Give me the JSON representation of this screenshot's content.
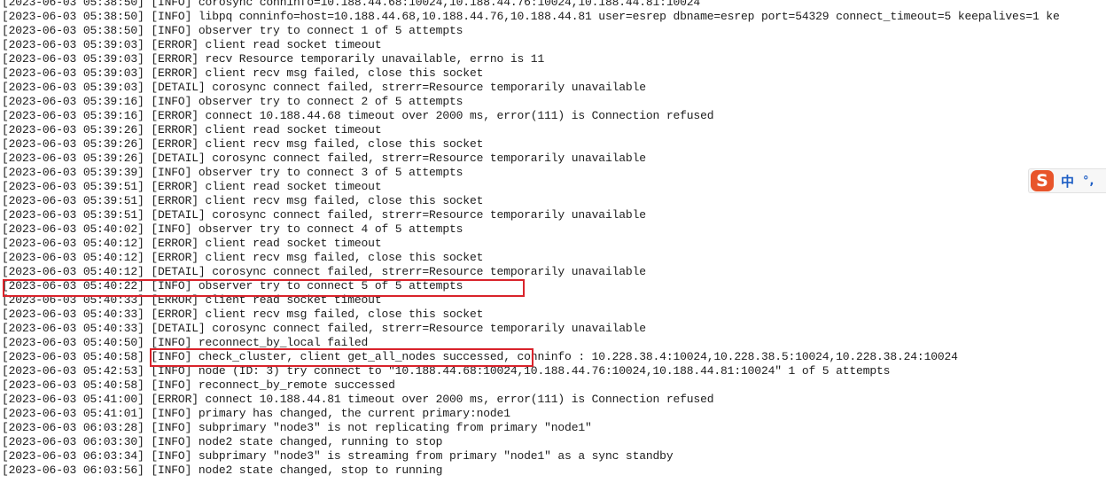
{
  "log": {
    "lines": [
      "[2023-06-03 05:38:50] [INFO] corosync conninfo=10.188.44.68:10024,10.188.44.76:10024,10.188.44.81:10024",
      "[2023-06-03 05:38:50] [INFO] libpq conninfo=host=10.188.44.68,10.188.44.76,10.188.44.81 user=esrep dbname=esrep port=54329 connect_timeout=5 keepalives=1 ke",
      "[2023-06-03 05:38:50] [INFO] observer try to connect 1 of 5 attempts",
      "[2023-06-03 05:39:03] [ERROR] client read socket timeout",
      "[2023-06-03 05:39:03] [ERROR] recv Resource temporarily unavailable, errno is 11",
      "[2023-06-03 05:39:03] [ERROR] client recv msg failed, close this socket",
      "[2023-06-03 05:39:03] [DETAIL] corosync connect failed, strerr=Resource temporarily unavailable",
      "[2023-06-03 05:39:16] [INFO] observer try to connect 2 of 5 attempts",
      "[2023-06-03 05:39:16] [ERROR] connect 10.188.44.68 timeout over 2000 ms, error(111) is Connection refused",
      "[2023-06-03 05:39:26] [ERROR] client read socket timeout",
      "[2023-06-03 05:39:26] [ERROR] client recv msg failed, close this socket",
      "[2023-06-03 05:39:26] [DETAIL] corosync connect failed, strerr=Resource temporarily unavailable",
      "[2023-06-03 05:39:39] [INFO] observer try to connect 3 of 5 attempts",
      "[2023-06-03 05:39:51] [ERROR] client read socket timeout",
      "[2023-06-03 05:39:51] [ERROR] client recv msg failed, close this socket",
      "[2023-06-03 05:39:51] [DETAIL] corosync connect failed, strerr=Resource temporarily unavailable",
      "[2023-06-03 05:40:02] [INFO] observer try to connect 4 of 5 attempts",
      "[2023-06-03 05:40:12] [ERROR] client read socket timeout",
      "[2023-06-03 05:40:12] [ERROR] client recv msg failed, close this socket",
      "[2023-06-03 05:40:12] [DETAIL] corosync connect failed, strerr=Resource temporarily unavailable",
      "[2023-06-03 05:40:22] [INFO] observer try to connect 5 of 5 attempts",
      "[2023-06-03 05:40:33] [ERROR] client read socket timeout",
      "[2023-06-03 05:40:33] [ERROR] client recv msg failed, close this socket",
      "[2023-06-03 05:40:33] [DETAIL] corosync connect failed, strerr=Resource temporarily unavailable",
      "[2023-06-03 05:40:50] [INFO] reconnect_by_local failed",
      "[2023-06-03 05:40:58] [INFO] check_cluster, client get_all_nodes successed, conninfo : 10.228.38.4:10024,10.228.38.5:10024,10.228.38.24:10024",
      "[2023-06-03 05:42:53] [INFO] node (ID: 3) try connect to \"10.188.44.68:10024,10.188.44.76:10024,10.188.44.81:10024\" 1 of 5 attempts",
      "[2023-06-03 05:40:58] [INFO] reconnect_by_remote successed",
      "[2023-06-03 05:41:00] [ERROR] connect 10.188.44.81 timeout over 2000 ms, error(111) is Connection refused",
      "[2023-06-03 05:41:01] [INFO] primary has changed, the current primary:node1",
      "[2023-06-03 06:03:28] [INFO] subprimary \"node3\" is not replicating from primary \"node1\"",
      "[2023-06-03 06:03:30] [INFO] node2 state changed, running to stop",
      "[2023-06-03 06:03:34] [INFO] subprimary \"node3\" is streaming from primary \"node1\" as a sync standby",
      "[2023-06-03 06:03:56] [INFO] node2 state changed, stop to running"
    ]
  },
  "highlights": [
    {
      "name": "highlight-observer-attempt-5",
      "color": "#d9232b"
    },
    {
      "name": "highlight-check-cluster",
      "color": "#d9232b"
    }
  ],
  "ime": {
    "logo": "S",
    "mode": "中",
    "punct": "°,",
    "icon": "sogou-ime-icon"
  }
}
